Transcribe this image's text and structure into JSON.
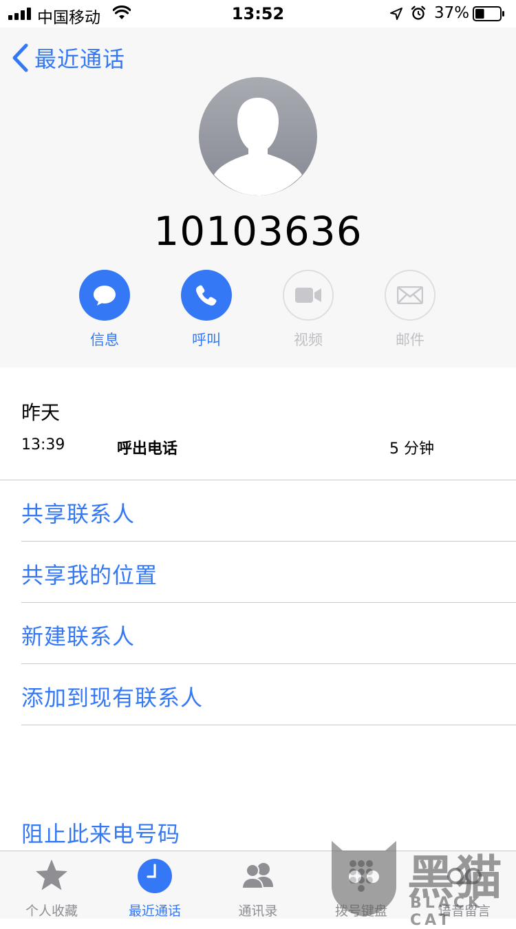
{
  "status_bar": {
    "carrier": "中国移动",
    "time": "13:52",
    "battery_percent": "37%",
    "battery_level": 0.37,
    "icons": [
      "signal-icon",
      "wifi-icon",
      "location-arrow-icon",
      "alarm-icon",
      "battery-icon"
    ]
  },
  "nav": {
    "back_label": "最近通话"
  },
  "contact": {
    "number": "10103636"
  },
  "actions": [
    {
      "label": "信息",
      "icon": "message-icon",
      "enabled": true
    },
    {
      "label": "呼叫",
      "icon": "phone-icon",
      "enabled": true
    },
    {
      "label": "视频",
      "icon": "video-icon",
      "enabled": false
    },
    {
      "label": "邮件",
      "icon": "mail-icon",
      "enabled": false
    }
  ],
  "call_log": {
    "day": "昨天",
    "entries": [
      {
        "time": "13:39",
        "type": "呼出电话",
        "duration": "5 分钟"
      }
    ]
  },
  "options": [
    "共享联系人",
    "共享我的位置",
    "新建联系人",
    "添加到现有联系人"
  ],
  "block_label": "阻止此来电号码",
  "tabs": [
    {
      "label": "个人收藏",
      "icon": "star-icon",
      "active": false
    },
    {
      "label": "最近通话",
      "icon": "clock-icon",
      "active": true
    },
    {
      "label": "通讯录",
      "icon": "contacts-icon",
      "active": false
    },
    {
      "label": "拨号键盘",
      "icon": "keypad-icon",
      "active": false
    },
    {
      "label": "语音留言",
      "icon": "voicemail-icon",
      "active": false
    }
  ],
  "watermark": {
    "text": "黑猫",
    "sub": "BLACK CAT"
  },
  "colors": {
    "accent": "#3478f6",
    "disabled": "#bfbfc4",
    "header_bg": "#f7f7f8",
    "separator": "#c8c7cc"
  }
}
